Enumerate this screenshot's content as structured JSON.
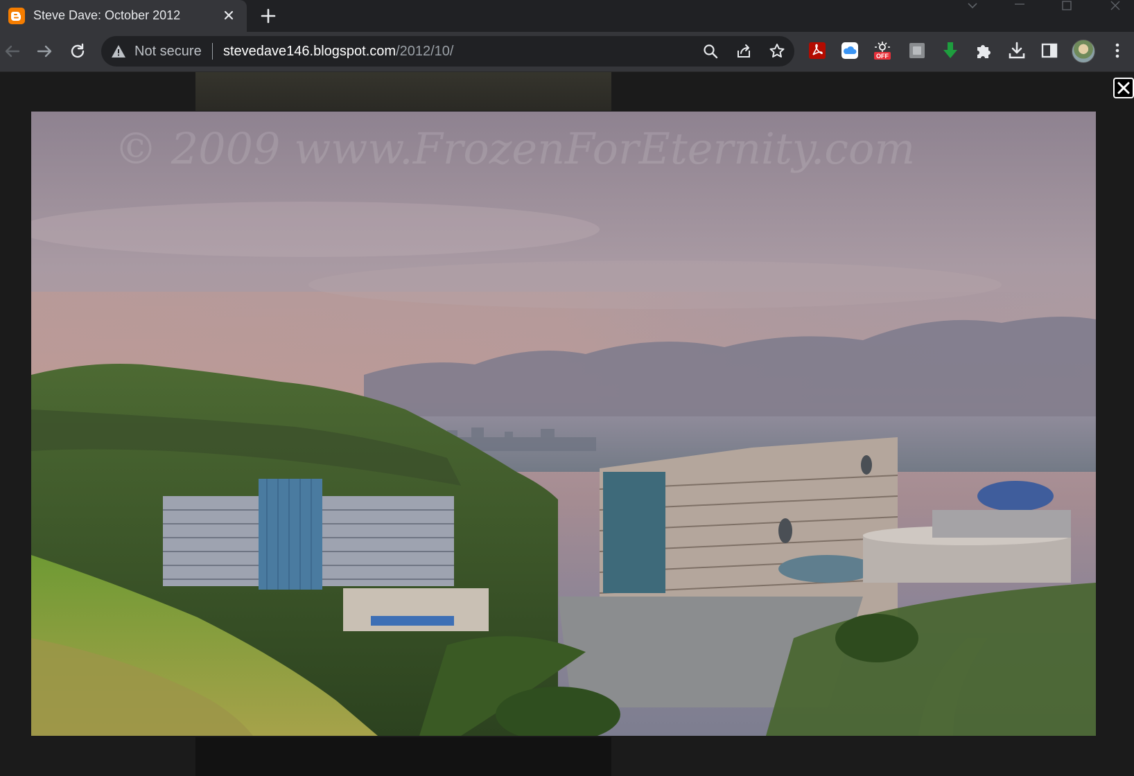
{
  "tab": {
    "title": "Steve Dave: October 2012",
    "favicon": "blogger-icon"
  },
  "address_bar": {
    "security_label": "Not secure",
    "url_domain": "stevedave146.blogspot.com",
    "url_path": "/2012/10/"
  },
  "toolbar_icons": [
    "back-icon",
    "forward-icon",
    "reload-icon",
    "zoom-icon",
    "share-icon",
    "bookmark-star-icon"
  ],
  "extensions": [
    "acrobat-icon",
    "icloud-icon",
    "dark-mode-off-icon",
    "generic-extension-icon",
    "download-arrow-icon",
    "puzzle-icon",
    "downloads-icon",
    "side-panel-icon",
    "profile-avatar",
    "menu-kebab-icon"
  ],
  "extension_badge": "OFF",
  "lightbox": {
    "watermark": "© 2009 www.FrozenForEternity.com",
    "close_icon": "close-icon"
  },
  "colors": {
    "favicon": "#f57d00",
    "chrome_dark": "#202124",
    "chrome_tab": "#35363a",
    "acrobat_red": "#b30b00",
    "download_green": "#1e9e3e"
  }
}
